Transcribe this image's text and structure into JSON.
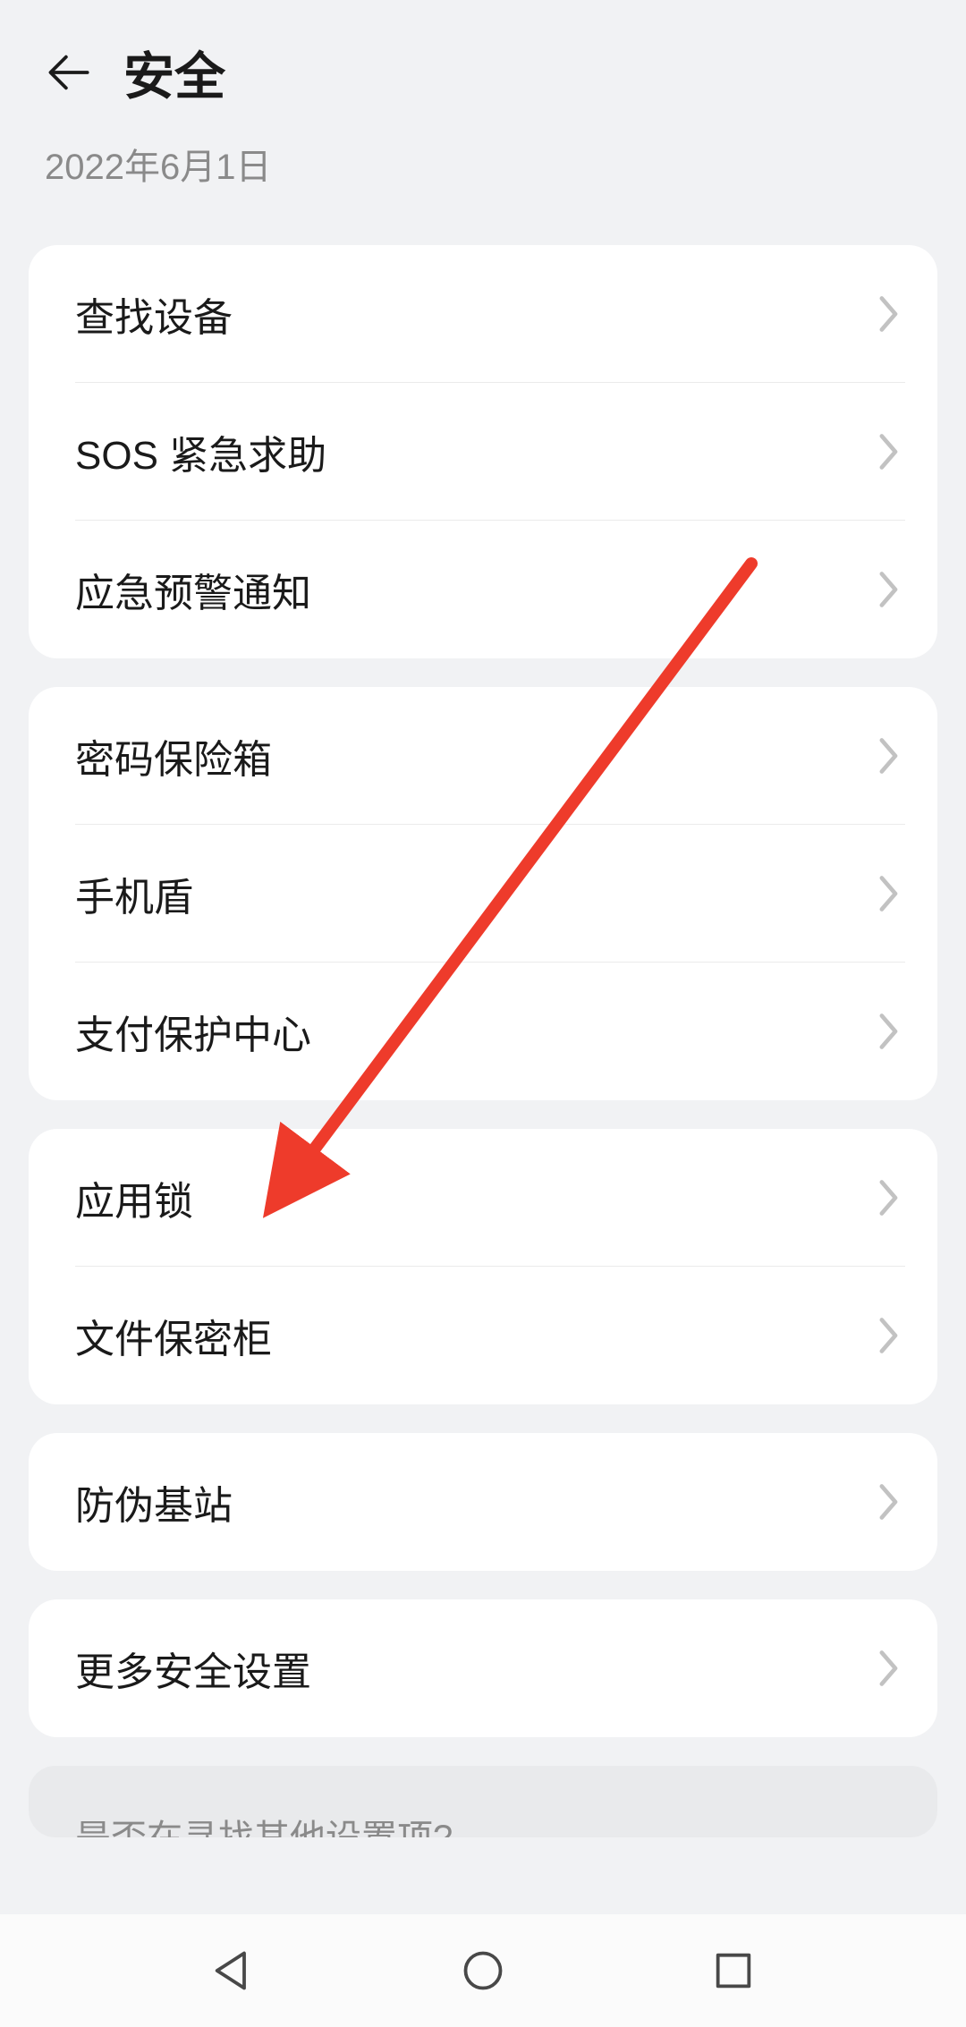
{
  "header": {
    "title": "安全",
    "date": "2022年6月1日"
  },
  "groups": [
    {
      "items": [
        {
          "id": "find-device",
          "label": "查找设备"
        },
        {
          "id": "sos",
          "label": "SOS 紧急求助"
        },
        {
          "id": "emergency-alert",
          "label": "应急预警通知"
        }
      ]
    },
    {
      "items": [
        {
          "id": "password-vault",
          "label": "密码保险箱"
        },
        {
          "id": "phone-shield",
          "label": "手机盾"
        },
        {
          "id": "payment-protect",
          "label": "支付保护中心"
        }
      ]
    },
    {
      "items": [
        {
          "id": "app-lock",
          "label": "应用锁"
        },
        {
          "id": "file-safe",
          "label": "文件保密柜"
        }
      ]
    },
    {
      "items": [
        {
          "id": "fake-base",
          "label": "防伪基站"
        }
      ]
    },
    {
      "items": [
        {
          "id": "more-security",
          "label": "更多安全设置"
        }
      ]
    }
  ],
  "footerHint": "是否在寻找其他设置项?",
  "annotation": {
    "color": "#ee3b2b"
  }
}
